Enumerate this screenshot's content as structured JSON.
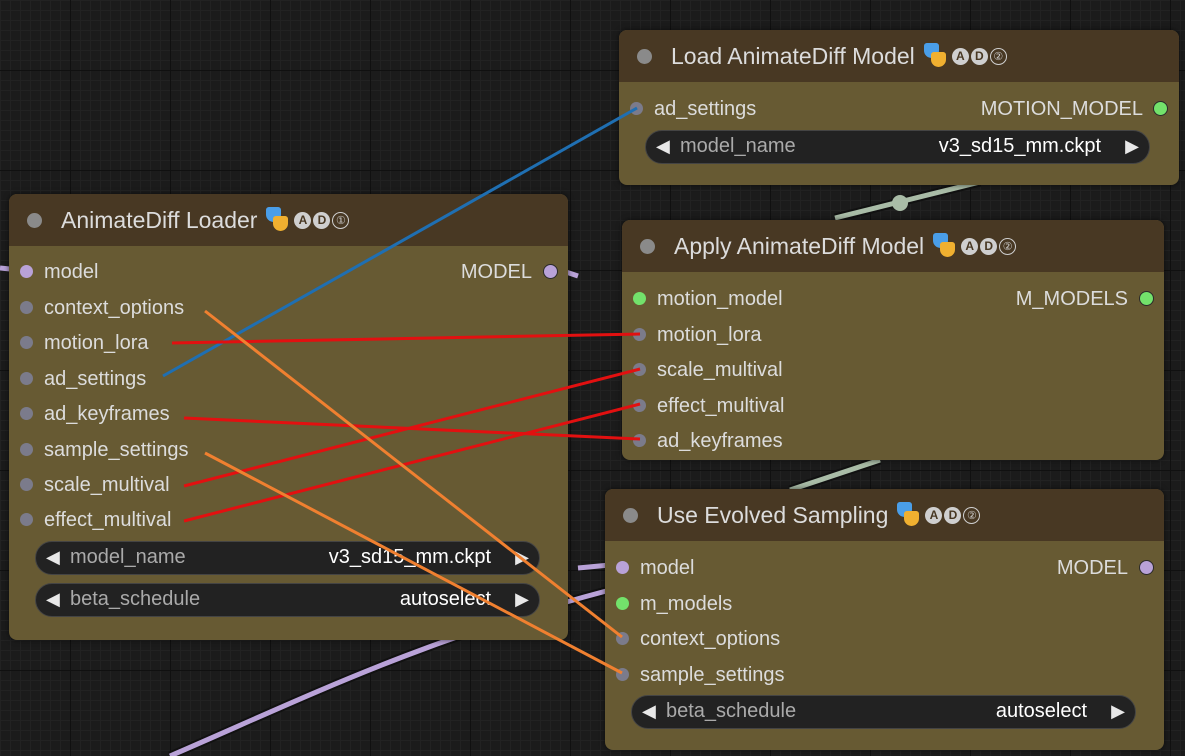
{
  "nodes": {
    "loader": {
      "title": "AnimateDiff Loader",
      "badge_a": "A",
      "badge_d": "D",
      "badge_num": "①",
      "inputs": [
        "model",
        "context_options",
        "motion_lora",
        "ad_settings",
        "ad_keyframes",
        "sample_settings",
        "scale_multival",
        "effect_multival"
      ],
      "output": "MODEL",
      "widgets": [
        {
          "name": "model_name",
          "value": "v3_sd15_mm.ckpt"
        },
        {
          "name": "beta_schedule",
          "value": "autoselect"
        }
      ]
    },
    "load_model": {
      "title": "Load AnimateDiff Model",
      "badge_a": "A",
      "badge_d": "D",
      "badge_num": "②",
      "inputs": [
        "ad_settings"
      ],
      "output": "MOTION_MODEL",
      "widgets": [
        {
          "name": "model_name",
          "value": "v3_sd15_mm.ckpt"
        }
      ]
    },
    "apply_model": {
      "title": "Apply AnimateDiff Model",
      "badge_a": "A",
      "badge_d": "D",
      "badge_num": "②",
      "inputs": [
        "motion_model",
        "motion_lora",
        "scale_multival",
        "effect_multival",
        "ad_keyframes"
      ],
      "output": "M_MODELS"
    },
    "evolved_sampling": {
      "title": "Use Evolved Sampling",
      "badge_a": "A",
      "badge_d": "D",
      "badge_num": "②",
      "inputs": [
        "model",
        "m_models",
        "context_options",
        "sample_settings"
      ],
      "output": "MODEL",
      "widgets": [
        {
          "name": "beta_schedule",
          "value": "autoselect"
        }
      ]
    }
  },
  "icons": {
    "arrow_left": "◀",
    "arrow_right": "▶",
    "node_icon": "theater-masks-icon"
  },
  "colors": {
    "node_body": "#675a33",
    "node_header": "#483823",
    "link_blue": "#1f6fb2",
    "link_red": "#e21010",
    "link_orange": "#f08030",
    "link_purple": "#b9a2d8",
    "link_green": "#a9bca7"
  }
}
